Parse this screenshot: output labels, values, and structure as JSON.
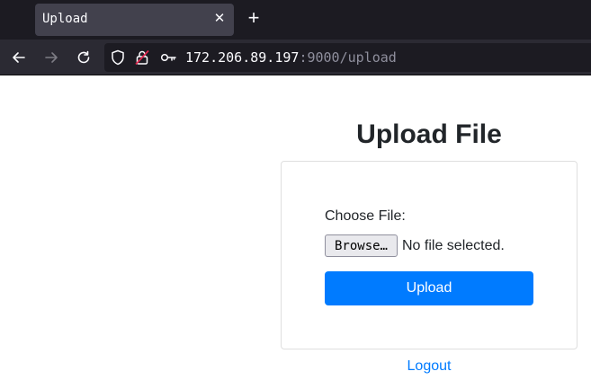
{
  "browser": {
    "tab": {
      "title": "Upload",
      "close_glyph": "✕"
    },
    "new_tab_glyph": "+",
    "url": {
      "host": "172.206.89.197",
      "path": ":9000/upload"
    },
    "icons": [
      "back-arrow-icon",
      "forward-arrow-icon",
      "reload-icon",
      "shield-icon",
      "insecure-lock-icon",
      "key-icon"
    ]
  },
  "page": {
    "heading": "Upload File",
    "file_label": "Choose File:",
    "browse_label": "Browse…",
    "no_file_text": "No file selected.",
    "upload_label": "Upload",
    "logout_label": "Logout"
  },
  "colors": {
    "primary": "#007bff",
    "text": "#212529",
    "chrome_dark": "#1c1b22",
    "chrome_tab": "#42414d"
  }
}
